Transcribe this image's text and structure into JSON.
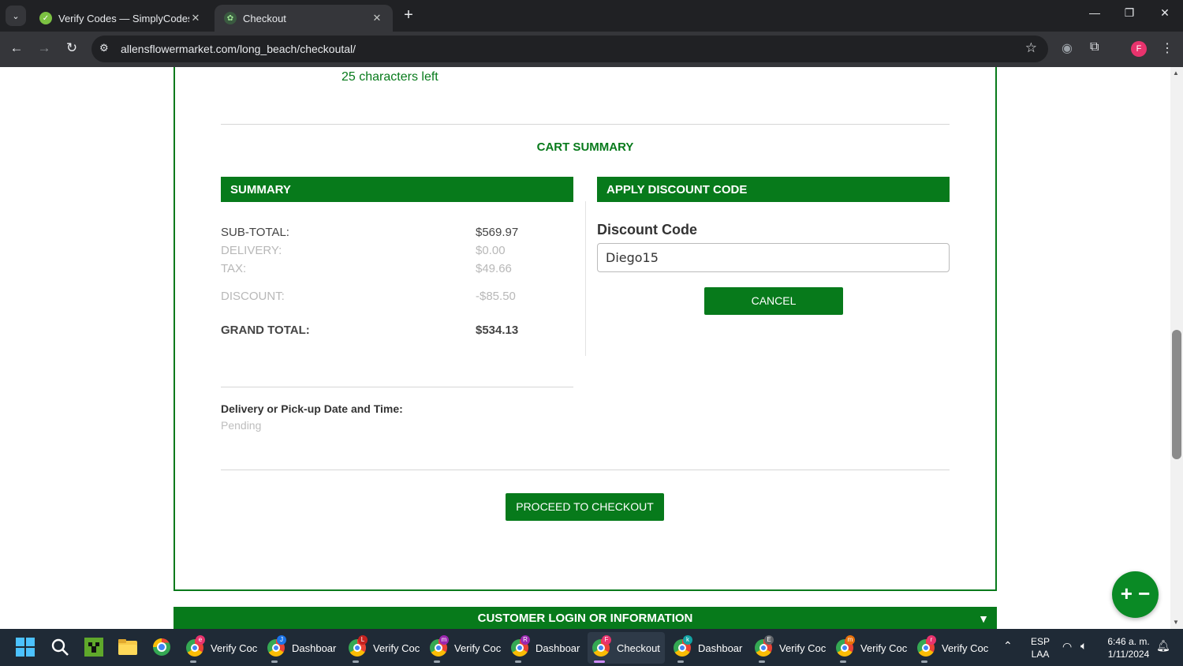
{
  "browser": {
    "tabs": [
      {
        "title": "Verify Codes — SimplyCodes",
        "active": false
      },
      {
        "title": "Checkout",
        "active": true
      }
    ],
    "url": "allensflowermarket.com/long_beach/checkoutal/",
    "profile_initial": "F"
  },
  "page": {
    "characters_left": "25 characters left",
    "cart_summary_title": "CART SUMMARY",
    "summary_header": "SUMMARY",
    "discount_header": "APPLY DISCOUNT CODE",
    "rows": [
      {
        "label": "SUB-TOTAL:",
        "value": "$569.97"
      },
      {
        "label": "DELIVERY:",
        "value": "$0.00"
      },
      {
        "label": "TAX:",
        "value": "$49.66"
      },
      {
        "label": "DISCOUNT:",
        "value": "-$85.50"
      },
      {
        "label": "GRAND TOTAL:",
        "value": "$534.13"
      }
    ],
    "discount_label": "Discount Code",
    "discount_value": "Diego15",
    "cancel_label": "CANCEL",
    "delivery_label": "Delivery or Pick-up Date and Time:",
    "delivery_value": "Pending",
    "proceed_label": "PROCEED TO CHECKOUT",
    "login_bar_label": "CUSTOMER LOGIN OR INFORMATION",
    "login_caret": "▼",
    "zoom_fab_label": "+ −"
  },
  "taskbar": {
    "items": [
      {
        "label": "Verify Coc",
        "badge": "e",
        "badge_color": "#e8336d"
      },
      {
        "label": "Dashboar",
        "badge": "J",
        "badge_color": "#1a73e8"
      },
      {
        "label": "Verify Coc",
        "badge": "L",
        "badge_color": "#c5221f"
      },
      {
        "label": "Verify Coc",
        "badge": "m",
        "badge_color": "#9c27b0"
      },
      {
        "label": "Dashboar",
        "badge": "R",
        "badge_color": "#9c27b0"
      },
      {
        "label": "Checkout",
        "badge": "F",
        "badge_color": "#e8336d",
        "active": true
      },
      {
        "label": "Dashboar",
        "badge": "k",
        "badge_color": "#12a4a4"
      },
      {
        "label": "Verify Coc",
        "badge": "E",
        "badge_color": "#5f6368"
      },
      {
        "label": "Verify Coc",
        "badge": "m",
        "badge_color": "#e8710a"
      },
      {
        "label": "Verify Coc",
        "badge": "r",
        "badge_color": "#e8336d"
      }
    ],
    "lang": "ESP",
    "lang_sub": "LAA",
    "time": "6:46 a. m.",
    "date": "1/11/2024"
  },
  "colors": {
    "accent": "#077a1b",
    "muted_text": "#b8b8b8"
  }
}
